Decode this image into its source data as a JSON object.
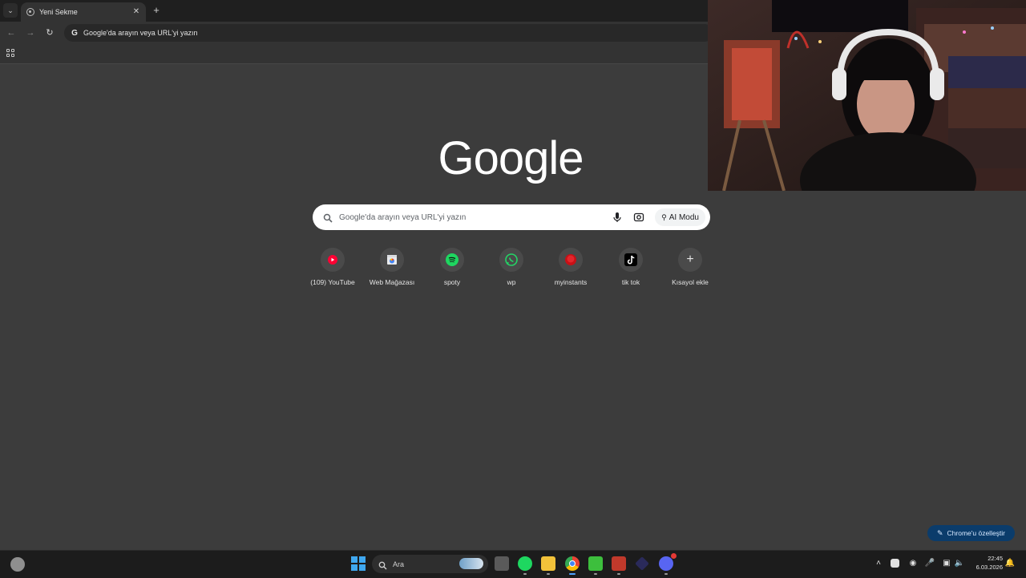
{
  "browser": {
    "tab_title": "Yeni Sekme",
    "omnibox_text": "Google'da arayın veya URL'yi yazın"
  },
  "page": {
    "logo_text": "Google",
    "search_placeholder": "Google'da arayın veya URL'yi yazın",
    "ai_mode_label": "AI Modu",
    "shortcuts": [
      {
        "label": "(109) YouTube",
        "icon": "youtube-icon"
      },
      {
        "label": "Web Mağazası",
        "icon": "web-store-icon"
      },
      {
        "label": "spoty",
        "icon": "spotify-icon"
      },
      {
        "label": "wp",
        "icon": "whatsapp-icon"
      },
      {
        "label": "myinstants",
        "icon": "myinstants-icon"
      },
      {
        "label": "tik tok",
        "icon": "tiktok-icon"
      },
      {
        "label": "Kısayol ekle",
        "icon": "add-icon"
      }
    ],
    "customize_label": "Chrome'u özelleştir"
  },
  "taskbar": {
    "search_label": "Ara",
    "time": "22:45",
    "date": "6.03.2026"
  },
  "colors": {
    "page_bg": "#3c3c3c",
    "youtube": "#ff0033",
    "spotify": "#1ed760",
    "whatsapp": "#25d366",
    "customize_bg": "#0b3c6b"
  }
}
